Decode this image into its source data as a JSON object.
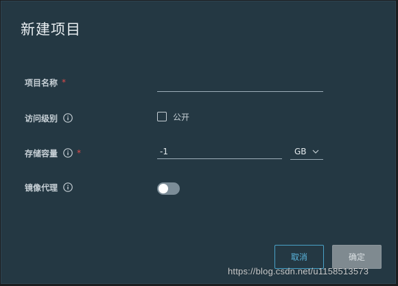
{
  "dialog": {
    "title": "新建项目",
    "fields": {
      "project_name": {
        "label": "项目名称",
        "required_mark": "*",
        "value": ""
      },
      "access_level": {
        "label": "访问级别",
        "info_icon": "info-circle-icon",
        "checkbox_label": "公开",
        "checked": false
      },
      "storage_quota": {
        "label": "存储容量",
        "info_icon": "info-circle-icon",
        "required_mark": "*",
        "value": "-1",
        "unit": "GB"
      },
      "mirror_proxy": {
        "label": "镜像代理",
        "info_icon": "info-circle-icon",
        "enabled": false
      }
    },
    "buttons": {
      "cancel": "取消",
      "confirm": "确定"
    }
  },
  "watermark": "https://blog.csdn.net/u1158513573",
  "colors": {
    "dialog_bg": "#243843",
    "accent": "#4aa3c9",
    "required": "#e04b4b",
    "confirm_bg": "#7f8a90"
  }
}
